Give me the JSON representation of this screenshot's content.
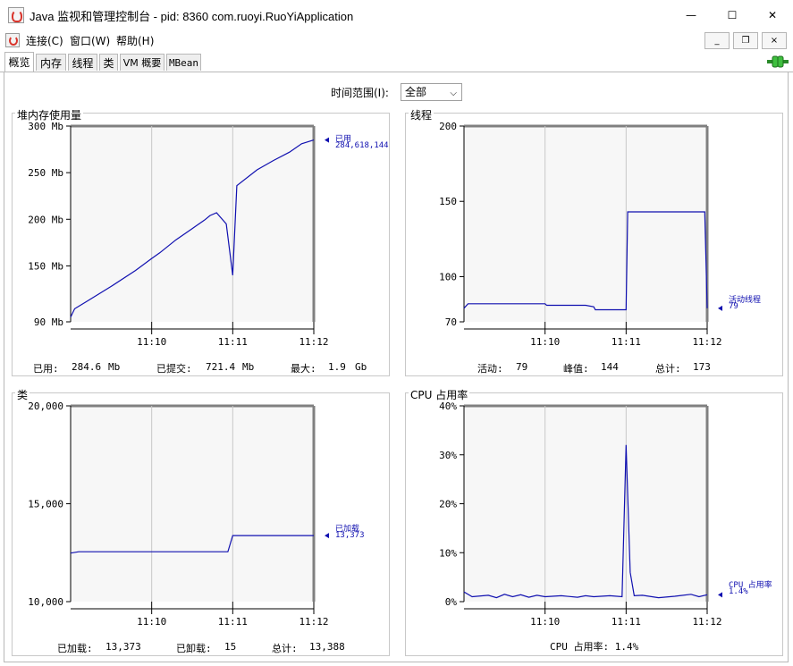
{
  "window": {
    "title": "Java 监视和管理控制台 - pid: 8360 com.ruoyi.RuoYiApplication",
    "minimize": "—",
    "maximize": "☐",
    "close": "✕"
  },
  "menu": {
    "items": [
      "连接(C)",
      "窗口(W)",
      "帮助(H)"
    ],
    "mdi_minimize": "_",
    "mdi_restore": "❐",
    "mdi_close": "×"
  },
  "tabs": [
    "概览",
    "内存",
    "线程",
    "类",
    "VM 概要",
    "MBean"
  ],
  "time_range": {
    "label": "时间范围(I):",
    "value": "全部"
  },
  "panels": {
    "heap": {
      "title": "堆内存使用量",
      "legend_name": "已用",
      "legend_value": "284,618,144",
      "stats": [
        {
          "label": "已用:",
          "value": "284.6",
          "unit": "Mb"
        },
        {
          "label": "已提交:",
          "value": "721.4",
          "unit": "Mb"
        },
        {
          "label": "最大:",
          "value": "1.9",
          "unit": "Gb"
        }
      ]
    },
    "threads": {
      "title": "线程",
      "legend_name": "活动线程",
      "legend_value": "79",
      "stats": [
        {
          "label": "活动:",
          "value": "79"
        },
        {
          "label": "峰值:",
          "value": "144"
        },
        {
          "label": "总计:",
          "value": "173"
        }
      ]
    },
    "classes": {
      "title": "类",
      "legend_name": "已加载",
      "legend_value": "13,373",
      "stats": [
        {
          "label": "已加载:",
          "value": "13,373"
        },
        {
          "label": "已卸载:",
          "value": "15"
        },
        {
          "label": "总计:",
          "value": "13,388"
        }
      ]
    },
    "cpu": {
      "title": "CPU 占用率",
      "legend_name": "CPU 占用率",
      "legend_value": "1.4%",
      "stats_text": "CPU 占用率: 1.4%"
    }
  },
  "colors": {
    "line": "#1010b0",
    "grid": "#c8c8c8",
    "plot_bg": "#f7f7f7",
    "accent": "#2ba52b"
  },
  "chart_data": [
    {
      "type": "line",
      "title": "堆内存使用量",
      "x_ticks": [
        "11:10",
        "11:11",
        "11:12"
      ],
      "y_ticks": [
        "300 Mb",
        "250 Mb",
        "200 Mb",
        "150 Mb",
        "90 Mb"
      ],
      "ylim": [
        90,
        300
      ],
      "y_tick_values": [
        300,
        250,
        200,
        150,
        90
      ],
      "x_domain": [
        0,
        3
      ],
      "x_tick_values": [
        1,
        2,
        3
      ],
      "series": [
        {
          "name": "已用",
          "x": [
            0,
            0.05,
            0.2,
            0.5,
            0.8,
            1.0,
            1.1,
            1.3,
            1.5,
            1.65,
            1.72,
            1.8,
            1.92,
            2.0,
            2.05,
            2.3,
            2.5,
            2.7,
            2.85,
            3.0
          ],
          "y": [
            95,
            104,
            112,
            128,
            145,
            158,
            164,
            178,
            190,
            199,
            204,
            207,
            195,
            140,
            236,
            253,
            263,
            272,
            281,
            285
          ]
        }
      ]
    },
    {
      "type": "line",
      "title": "线程",
      "x_ticks": [
        "11:10",
        "11:11",
        "11:12"
      ],
      "y_ticks": [
        "200",
        "150",
        "100",
        "70"
      ],
      "ylim": [
        70,
        200
      ],
      "y_tick_values": [
        200,
        150,
        100,
        70
      ],
      "x_domain": [
        0,
        3
      ],
      "x_tick_values": [
        1,
        2,
        3
      ],
      "series": [
        {
          "name": "活动线程",
          "x": [
            0,
            0.05,
            1.0,
            1.02,
            1.5,
            1.6,
            1.62,
            1.95,
            2.0,
            2.02,
            2.97,
            3.0
          ],
          "y": [
            79,
            82,
            82,
            81,
            81,
            80,
            78,
            78,
            78,
            143,
            143,
            79
          ]
        }
      ]
    },
    {
      "type": "line",
      "title": "类",
      "x_ticks": [
        "11:10",
        "11:11",
        "11:12"
      ],
      "y_ticks": [
        "20,000",
        "15,000",
        "10,000"
      ],
      "ylim": [
        10000,
        20000
      ],
      "y_tick_values": [
        20000,
        15000,
        10000
      ],
      "x_domain": [
        0,
        3
      ],
      "x_tick_values": [
        1,
        2,
        3
      ],
      "series": [
        {
          "name": "已加载",
          "x": [
            0,
            0.1,
            1.0,
            1.8,
            1.94,
            2.0,
            3.0
          ],
          "y": [
            12480,
            12550,
            12550,
            12550,
            12550,
            13373,
            13373
          ]
        }
      ]
    },
    {
      "type": "line",
      "title": "CPU 占用率",
      "x_ticks": [
        "11:10",
        "11:11",
        "11:12"
      ],
      "y_ticks": [
        "40%",
        "30%",
        "20%",
        "10%",
        "0%"
      ],
      "ylim": [
        0,
        40
      ],
      "y_tick_values": [
        40,
        30,
        20,
        10,
        0
      ],
      "x_domain": [
        0,
        3
      ],
      "x_tick_values": [
        1,
        2,
        3
      ],
      "series": [
        {
          "name": "CPU 占用率",
          "x": [
            0,
            0.1,
            0.3,
            0.4,
            0.5,
            0.6,
            0.7,
            0.8,
            0.9,
            1.0,
            1.2,
            1.4,
            1.5,
            1.6,
            1.8,
            1.95,
            2.0,
            2.05,
            2.1,
            2.2,
            2.4,
            2.6,
            2.8,
            2.9,
            3.0
          ],
          "y": [
            2,
            1,
            1.3,
            0.8,
            1.5,
            1,
            1.4,
            0.9,
            1.3,
            1,
            1.2,
            0.9,
            1.2,
            1,
            1.2,
            1,
            32,
            6,
            1.2,
            1.3,
            0.8,
            1.1,
            1.5,
            1,
            1.4
          ]
        }
      ]
    }
  ]
}
